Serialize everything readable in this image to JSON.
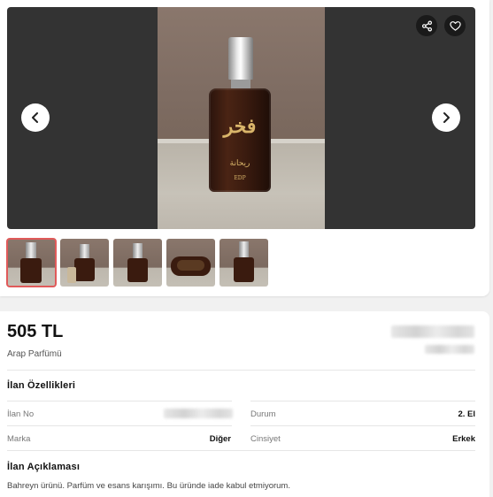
{
  "gallery": {
    "bottle_label_line1": "فخر",
    "bottle_label_line2": "ريحانة",
    "bottle_label_line3": "EDP",
    "thumbnail_count": 5
  },
  "listing": {
    "price": "505 TL",
    "category": "Arap Parfümü",
    "features_title": "İlan Özellikleri",
    "fields": {
      "ilan_no_label": "İlan No",
      "durum_label": "Durum",
      "durum_value": "2. El",
      "marka_label": "Marka",
      "marka_value": "Diğer",
      "cinsiyet_label": "Cinsiyet",
      "cinsiyet_value": "Erkek"
    },
    "description_title": "İlan Açıklaması",
    "description": "Bahreyn ürünü. Parfüm ve esans karışımı. Bu üründe iade kabul etmiyorum."
  },
  "colors": {
    "price": "#111111",
    "thumb_active_border": "#e05a5a",
    "viewer_background": "#333333"
  }
}
